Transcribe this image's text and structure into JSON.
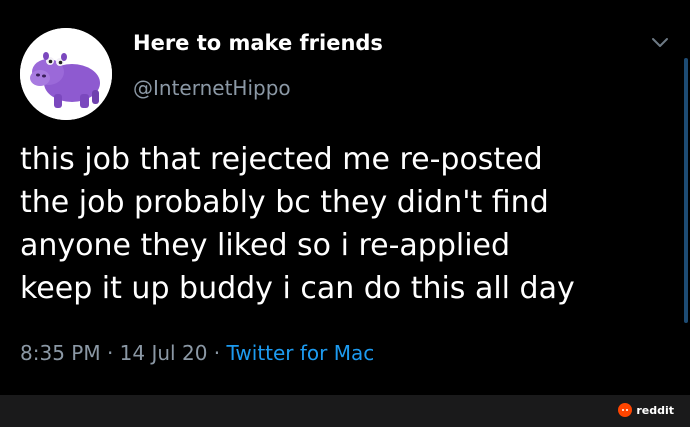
{
  "tweet": {
    "display_name": "Here to make friends",
    "handle": "@InternetHippo",
    "text_lines": [
      "this job that rejected me re-posted",
      "the job probably bc they didn't find",
      "anyone they liked so i re-applied",
      "keep it up buddy i can do this all day"
    ],
    "time": "8:35 PM",
    "separator": " · ",
    "date": "14 Jul 20",
    "source": "Twitter for Mac"
  },
  "watermark": {
    "label": "reddit"
  },
  "icons": {
    "avatar": "purple-hippo-avatar",
    "menu": "chevron-down-icon",
    "brand": "reddit-icon"
  },
  "colors": {
    "background": "#000000",
    "text": "#ffffff",
    "secondary": "#8b98a5",
    "link": "#1d9bf0",
    "reddit": "#ff4500"
  }
}
